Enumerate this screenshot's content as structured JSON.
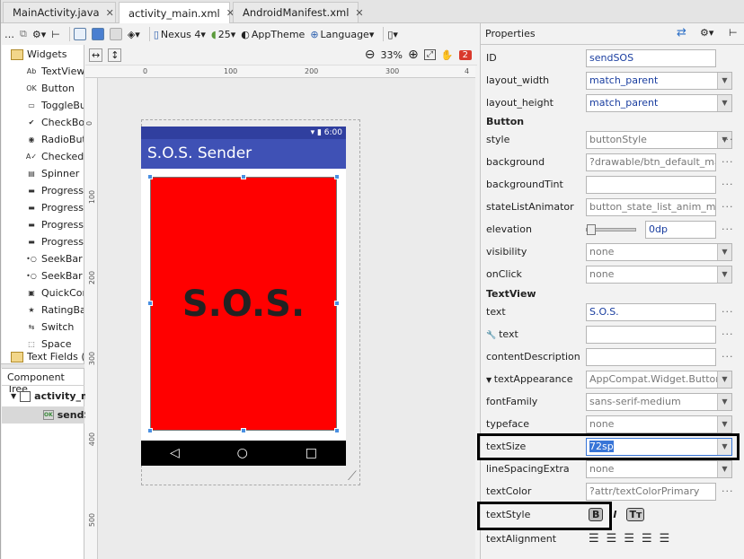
{
  "tabs": [
    {
      "label": "MainActivity.java",
      "color": "#5a8bd6",
      "active": false
    },
    {
      "label": "activity_main.xml",
      "color": "#e0a030",
      "active": true
    },
    {
      "label": "AndroidManifest.xml",
      "color": "#8fb04a",
      "active": false
    }
  ],
  "design_toolbar": {
    "device": "Nexus 4",
    "api": "25",
    "theme": "AppTheme",
    "language": "Language",
    "zoom": "33%",
    "error_count": "2"
  },
  "palette": {
    "category_widgets": "Widgets",
    "items": [
      "TextView",
      "Button",
      "ToggleButton",
      "CheckBox",
      "RadioButton",
      "CheckedTextView",
      "Spinner",
      "ProgressBar",
      "ProgressBar",
      "ProgressBar",
      "ProgressBar",
      "SeekBar",
      "SeekBar (Discrete)",
      "QuickContactBadge",
      "RatingBar",
      "Switch",
      "Space"
    ],
    "category_text": "Text Fields (Edit)"
  },
  "component_tree": {
    "title": "Component Tree",
    "root": "activity_main",
    "child": "sendSOS"
  },
  "ruler": {
    "h_ticks": [
      "0",
      "100",
      "200",
      "300",
      "4"
    ],
    "v_ticks": [
      "0",
      "100",
      "200",
      "300",
      "400",
      "500"
    ]
  },
  "device": {
    "time": "6:00",
    "app_title": "S.O.S. Sender",
    "button_text": "S.O.S."
  },
  "properties": {
    "title": "Properties",
    "id_label": "ID",
    "id_value": "sendSOS",
    "layout_width_label": "layout_width",
    "layout_width_value": "match_parent",
    "layout_height_label": "layout_height",
    "layout_height_value": "match_parent",
    "button_section": "Button",
    "style_label": "style",
    "style_value": "buttonStyle",
    "background_label": "background",
    "background_value": "?drawable/btn_default_mate",
    "backgroundTint_label": "backgroundTint",
    "backgroundTint_value": "",
    "stateListAnimator_label": "stateListAnimator",
    "stateListAnimator_value": "button_state_list_anim_mate",
    "elevation_label": "elevation",
    "elevation_value": "0dp",
    "visibility_label": "visibility",
    "visibility_value": "none",
    "onClick_label": "onClick",
    "onClick_value": "none",
    "textview_section": "TextView",
    "text_label": "text",
    "text_value": "S.O.S.",
    "text2_label": "text",
    "text2_value": "",
    "contentDescription_label": "contentDescription",
    "contentDescription_value": "",
    "textAppearance_label": "textAppearance",
    "textAppearance_value": "AppCompat.Widget.Button",
    "fontFamily_label": "fontFamily",
    "fontFamily_value": "sans-serif-medium",
    "typeface_label": "typeface",
    "typeface_value": "none",
    "textSize_label": "textSize",
    "textSize_value": "72sp",
    "lineSpacingExtra_label": "lineSpacingExtra",
    "lineSpacingExtra_value": "none",
    "textColor_label": "textColor",
    "textColor_value": "?attr/textColorPrimary",
    "textStyle_label": "textStyle",
    "textAlignment_label": "textAlignment"
  },
  "colors": {
    "app_bar": "#3f51b5",
    "status_bar": "#303f9f",
    "sos_button": "#ff0000",
    "highlight": "#000000"
  }
}
